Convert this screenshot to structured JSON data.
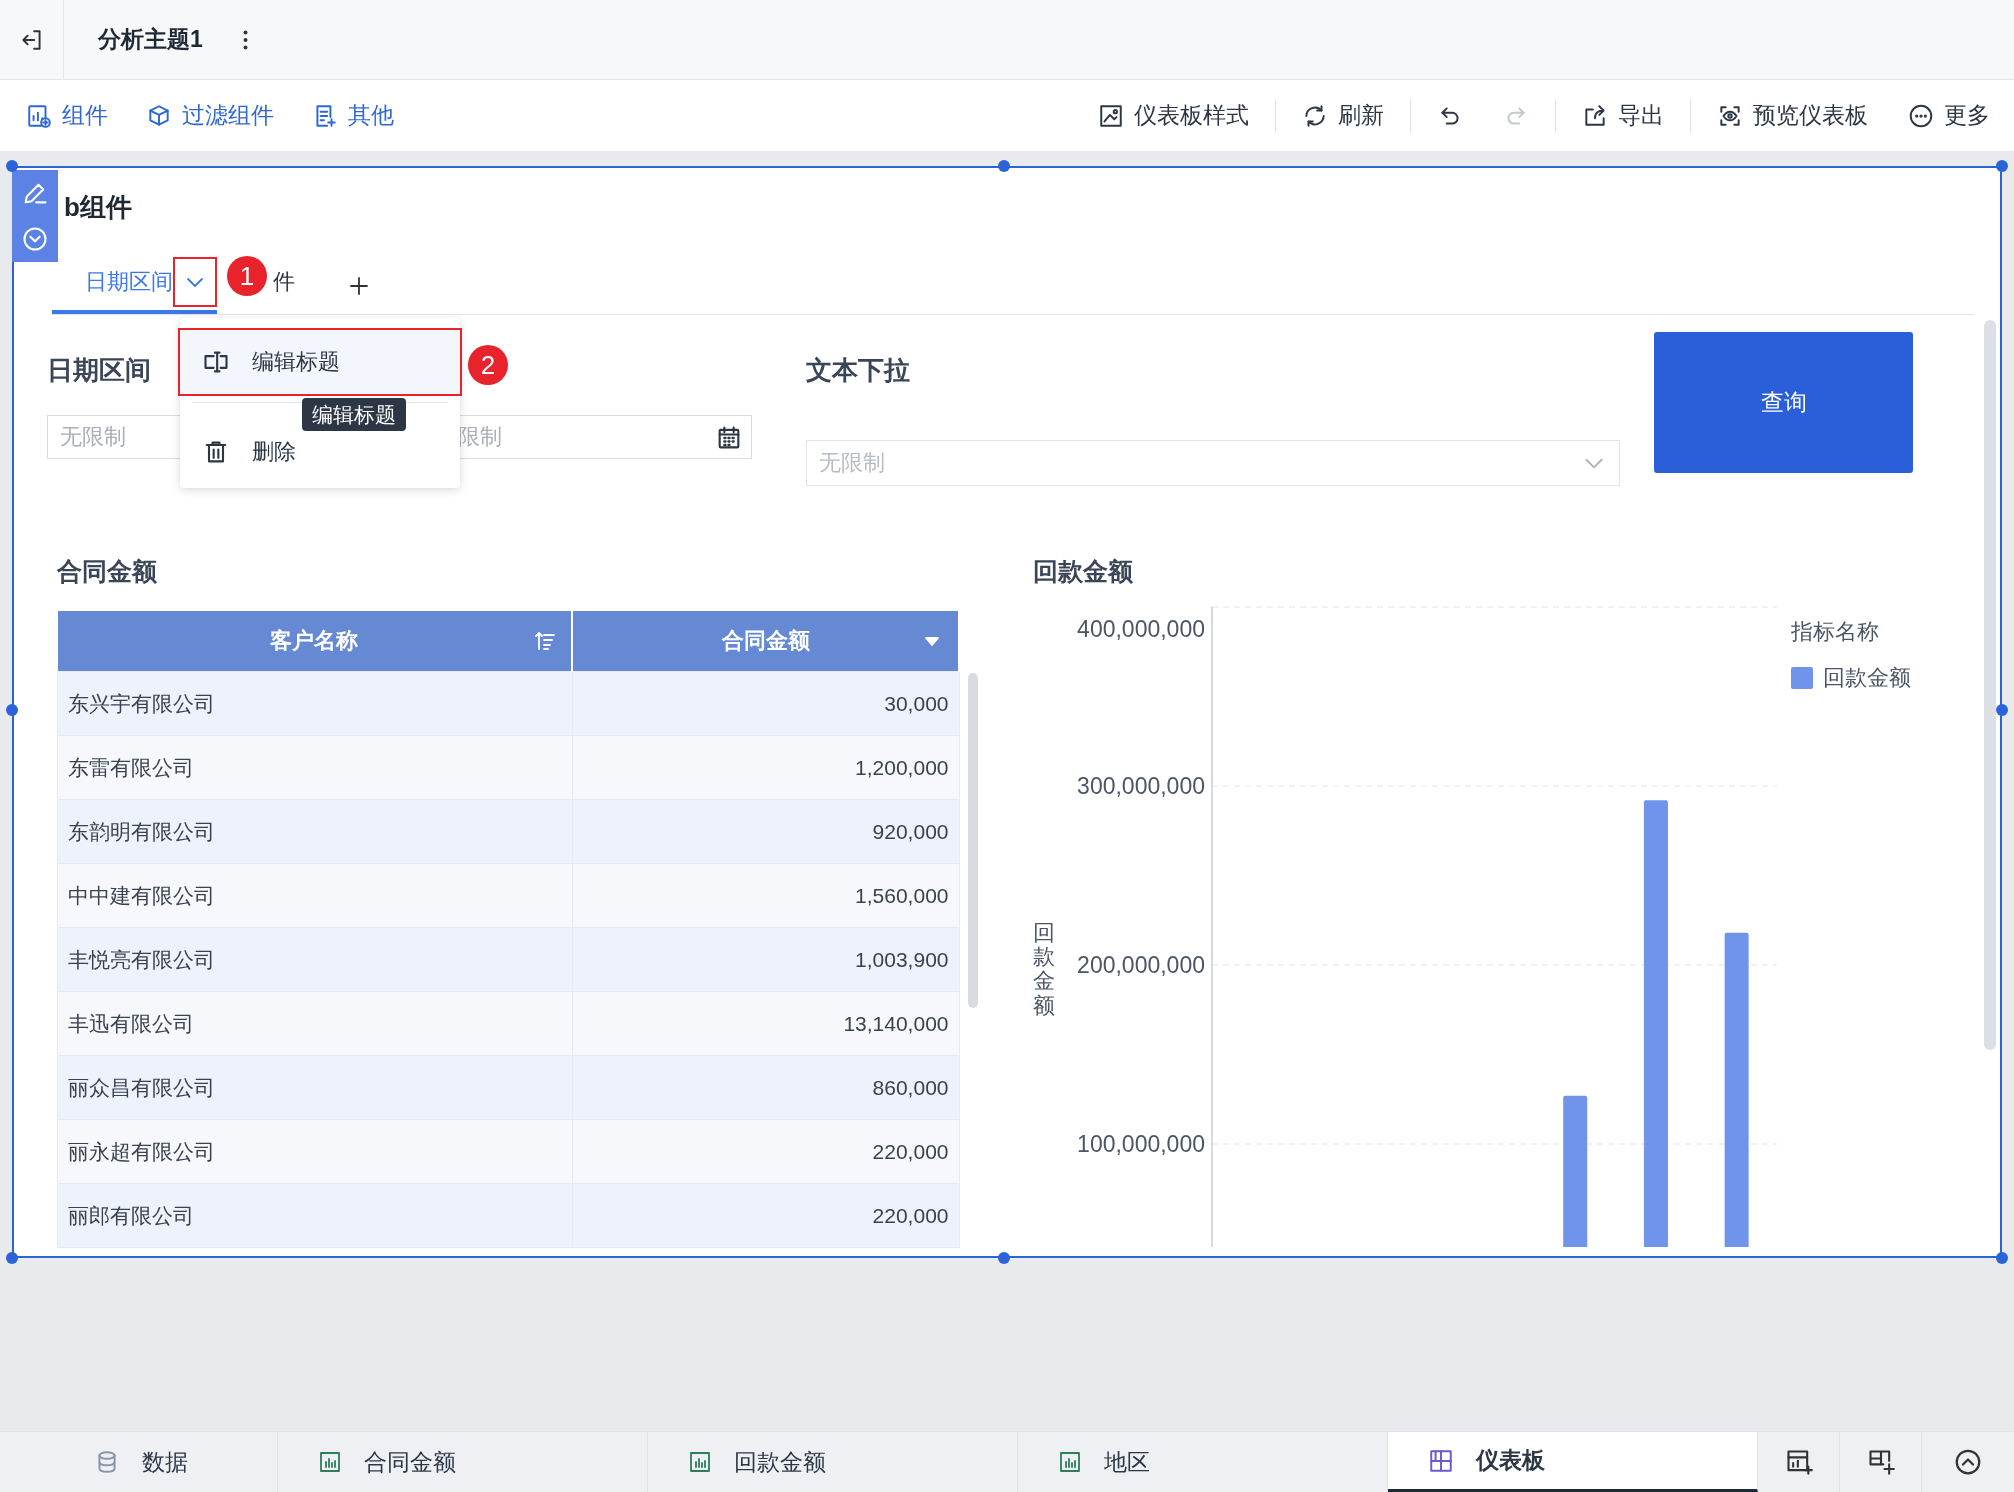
{
  "header": {
    "title": "分析主题1"
  },
  "toolbar": {
    "left": [
      {
        "label": "组件",
        "kind": "component"
      },
      {
        "label": "过滤组件",
        "kind": "filter"
      },
      {
        "label": "其他",
        "kind": "other"
      }
    ],
    "right": [
      {
        "label": "仪表板样式",
        "kind": "style"
      },
      {
        "label": "刷新",
        "kind": "refresh"
      },
      {
        "kind": "undo",
        "disabled": false
      },
      {
        "kind": "redo",
        "disabled": true
      },
      {
        "label": "导出",
        "kind": "export"
      },
      {
        "label": "预览仪表板",
        "kind": "preview"
      },
      {
        "label": "更多",
        "kind": "more"
      }
    ]
  },
  "component": {
    "title": "b组件",
    "tabs": [
      {
        "label": "日期区间",
        "selected": true
      },
      {
        "label": "件",
        "selected": false
      }
    ],
    "tab_menu": {
      "items": [
        {
          "label": "编辑标题",
          "kind": "rename",
          "highlighted": true
        },
        {
          "label": "删除",
          "kind": "delete",
          "highlighted": false
        }
      ],
      "tooltip": "编辑标题"
    },
    "annotations": [
      {
        "number": "1"
      },
      {
        "number": "2"
      }
    ],
    "filters": {
      "date_range": {
        "label": "日期区间",
        "start_placeholder": "无限制",
        "end_placeholder": "限制"
      },
      "text_dropdown": {
        "label": "文本下拉",
        "placeholder": "无限制"
      },
      "query_button": "查询"
    },
    "table": {
      "title": "合同金额",
      "columns": [
        {
          "label": "客户名称",
          "kind": "sort"
        },
        {
          "label": "合同金额",
          "kind": "dropdown"
        }
      ],
      "rows": [
        [
          "东兴宇有限公司",
          "30,000"
        ],
        [
          "东雷有限公司",
          "1,200,000"
        ],
        [
          "东韵明有限公司",
          "920,000"
        ],
        [
          "中中建有限公司",
          "1,560,000"
        ],
        [
          "丰悦亮有限公司",
          "1,003,900"
        ],
        [
          "丰迅有限公司",
          "13,140,000"
        ],
        [
          "丽众昌有限公司",
          "860,000"
        ],
        [
          "丽永超有限公司",
          "220,000"
        ],
        [
          "丽郎有限公司",
          "220,000"
        ]
      ]
    },
    "chart": {
      "title": "回款金额",
      "legend_title": "指标名称",
      "chart_data": {
        "type": "bar",
        "grid": true,
        "ylabel": "回款金额",
        "ylim": [
          0,
          400000000
        ],
        "yticks": [
          {
            "value": 100000000,
            "label": "100,000,000"
          },
          {
            "value": 200000000,
            "label": "200,000,000"
          },
          {
            "value": 300000000,
            "label": "300,000,000"
          },
          {
            "value": 400000000,
            "label": "400,000,000"
          }
        ],
        "series": [
          {
            "name": "回款金额",
            "color": "#7093ec",
            "values": [
              null,
              null,
              null,
              null,
              127000000,
              292000000,
              218000000
            ]
          }
        ]
      }
    }
  },
  "bottom_tabs": [
    {
      "label": "数据",
      "kind": "data",
      "selected": false
    },
    {
      "label": "合同金额",
      "kind": "chart",
      "selected": false
    },
    {
      "label": "回款金额",
      "kind": "chart",
      "selected": false
    },
    {
      "label": "地区",
      "kind": "chart",
      "selected": false
    },
    {
      "label": "仪表板",
      "kind": "dashboard",
      "selected": true
    }
  ]
}
